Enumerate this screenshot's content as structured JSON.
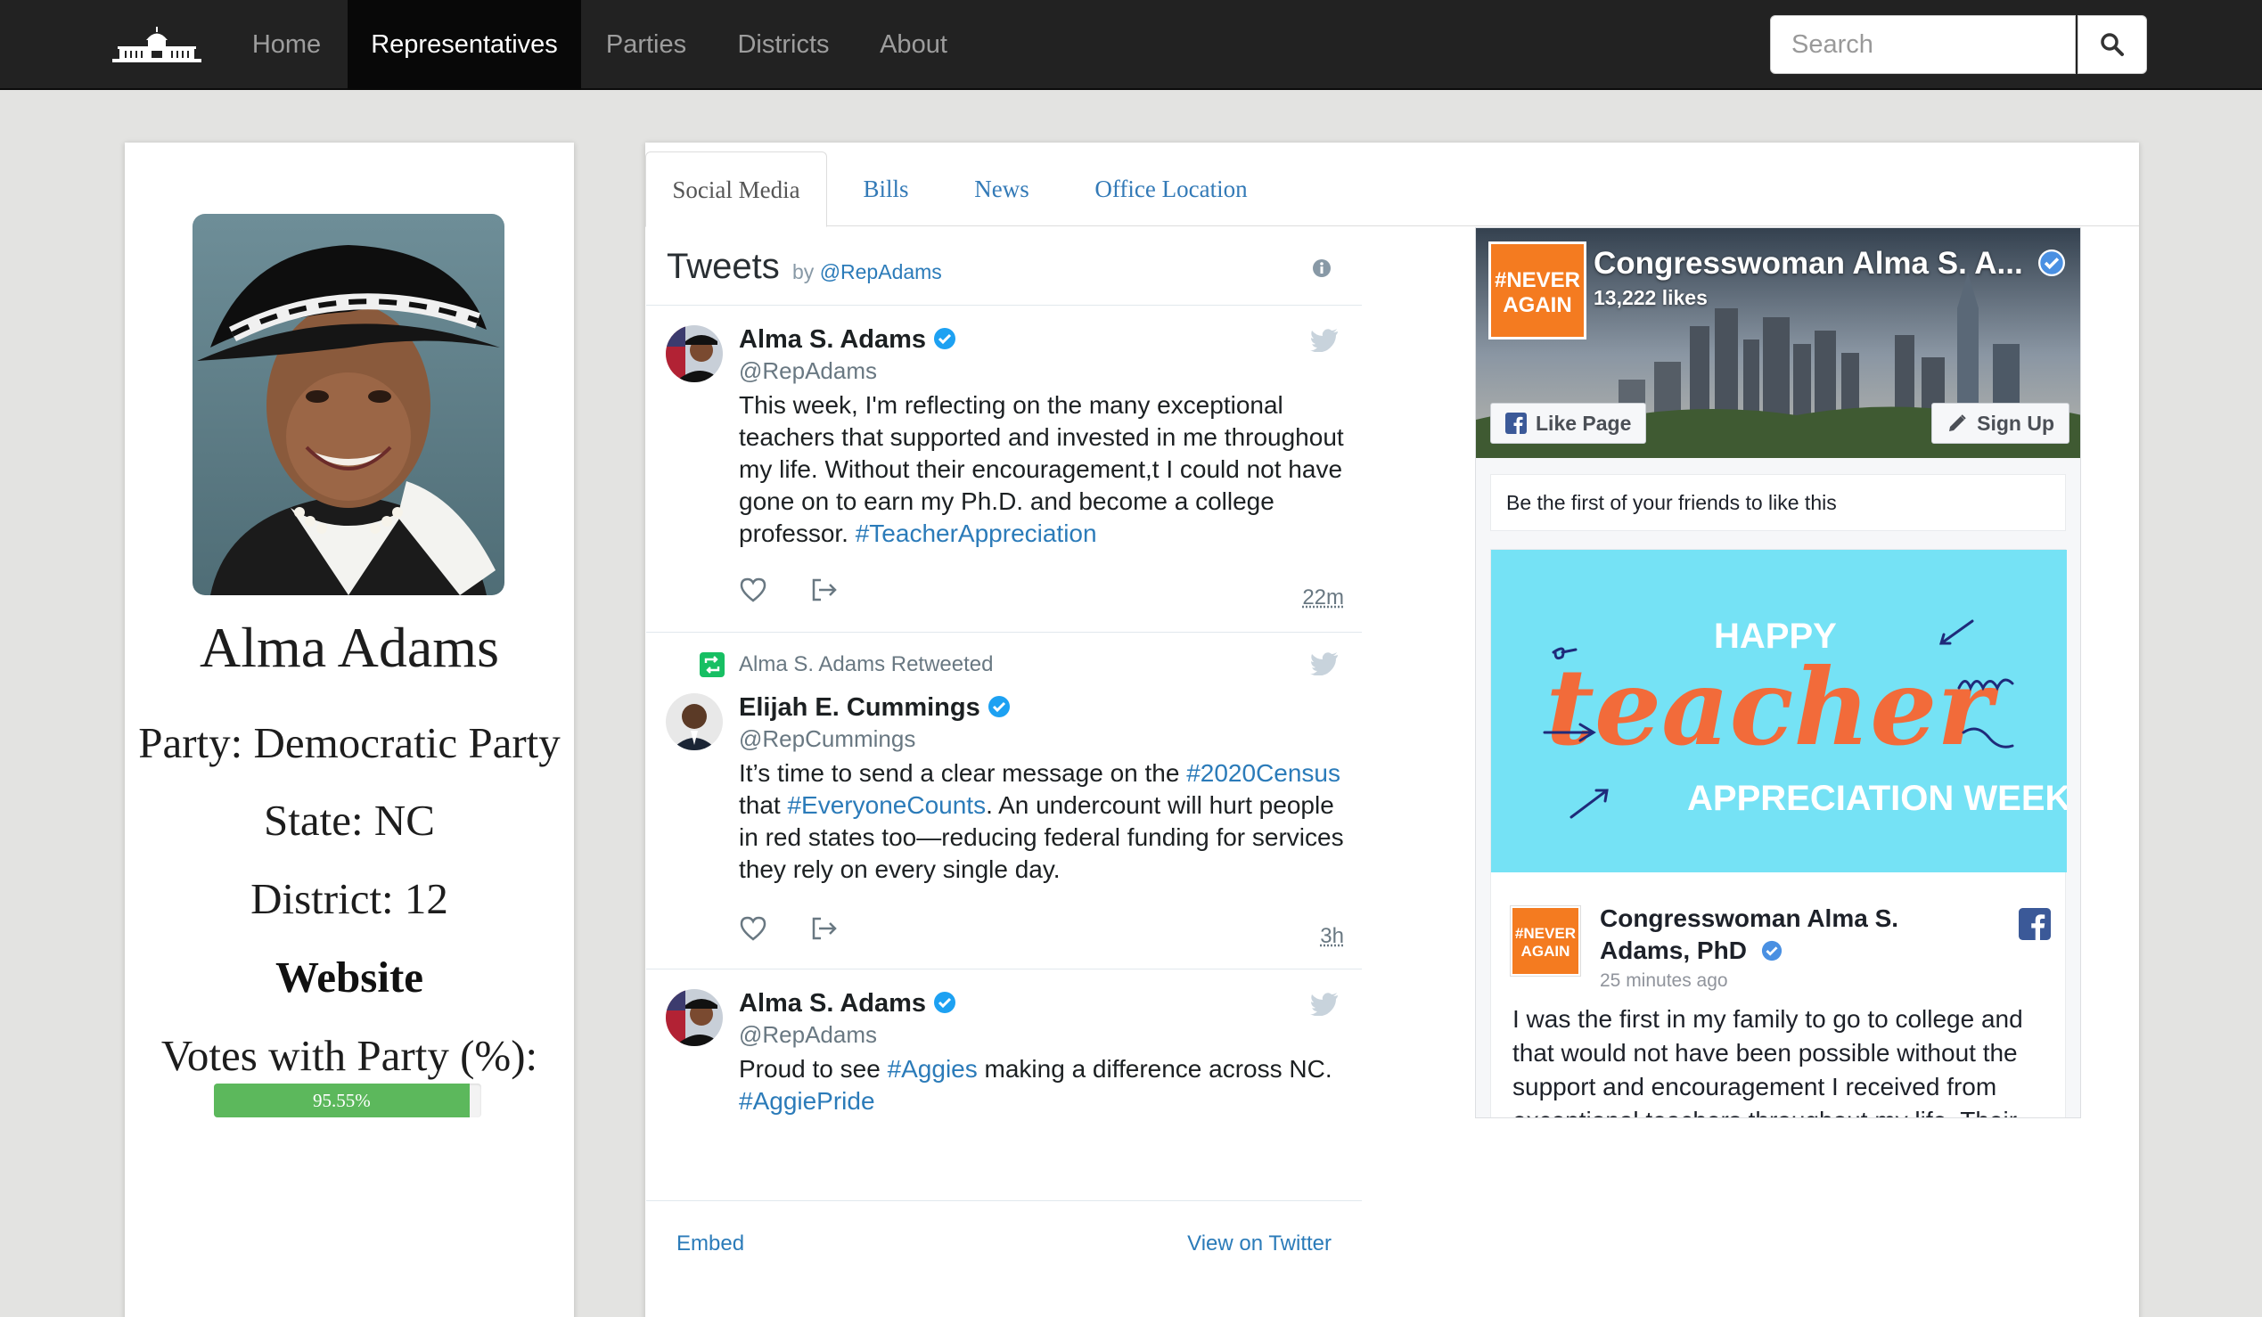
{
  "navbar": {
    "items": [
      {
        "label": "Home",
        "active": false
      },
      {
        "label": "Representatives",
        "active": true
      },
      {
        "label": "Parties",
        "active": false
      },
      {
        "label": "Districts",
        "active": false
      },
      {
        "label": "About",
        "active": false
      }
    ],
    "search": {
      "placeholder": "Search",
      "value": ""
    },
    "brand_icon": "capitol-building-icon",
    "search_icon": "search-icon"
  },
  "profile": {
    "name": "Alma Adams",
    "party": "Party: Democratic Party",
    "state": "State: NC",
    "district": "District: 12",
    "website": "Website",
    "votes_label": "Votes with Party (%):",
    "votes_value": "95.55%",
    "votes_fraction": 0.9555,
    "bar_color": "#5cb85c"
  },
  "tabs": [
    {
      "label": "Social Media",
      "active": true
    },
    {
      "label": "Bills",
      "active": false
    },
    {
      "label": "News",
      "active": false
    },
    {
      "label": "Office Location",
      "active": false
    }
  ],
  "twitter": {
    "title": "Tweets",
    "by": "by",
    "handle": "@RepAdams",
    "tweets": [
      {
        "author": "Alma S. Adams",
        "handle": "@RepAdams",
        "text_parts": [
          "This week, I'm reflecting on the many exceptional teachers that supported and invested in me throughout my life. Without their encouragement,t I could not have gone on to earn my Ph.D. and become a college professor. ",
          "#TeacherAppreciation"
        ],
        "time": "22m"
      },
      {
        "retweeted_by": "Alma S. Adams Retweeted",
        "author": "Elijah E. Cummings",
        "handle": "@RepCummings",
        "text_parts": [
          "It’s time to send a clear message on the ",
          "#2020Census",
          " that ",
          "#EveryoneCounts",
          ". An undercount will hurt people in red states too—reducing federal funding for services they rely on every single day."
        ],
        "time": "3h"
      },
      {
        "author": "Alma S. Adams",
        "handle": "@RepAdams",
        "text_parts": [
          "Proud to see ",
          "#Aggies",
          " making a difference across NC. ",
          "#AggiePride"
        ],
        "time": ""
      }
    ],
    "footer": {
      "embed": "Embed",
      "view": "View on Twitter"
    },
    "accent_color": "#2b7bb9"
  },
  "facebook": {
    "page_name": "Congresswoman Alma S. A...",
    "likes": "13,222 likes",
    "like_button": "Like Page",
    "signup_button": "Sign Up",
    "friends_text": "Be the first of your friends to like this",
    "logo_text": [
      "#NEVER",
      "AGAIN"
    ],
    "post": {
      "image_lines": [
        "HAPPY",
        "teacher",
        "APPRECIATION WEEK"
      ],
      "author": "Congresswoman Alma S. Adams, PhD",
      "time": "25 minutes ago",
      "text": "I was the first in my family to go to college and that would not have been possible without the support and encouragement I received from exceptional teachers throughout my life. Their"
    },
    "brand_color": "#3b5998",
    "logo_color": "#f47b20"
  }
}
